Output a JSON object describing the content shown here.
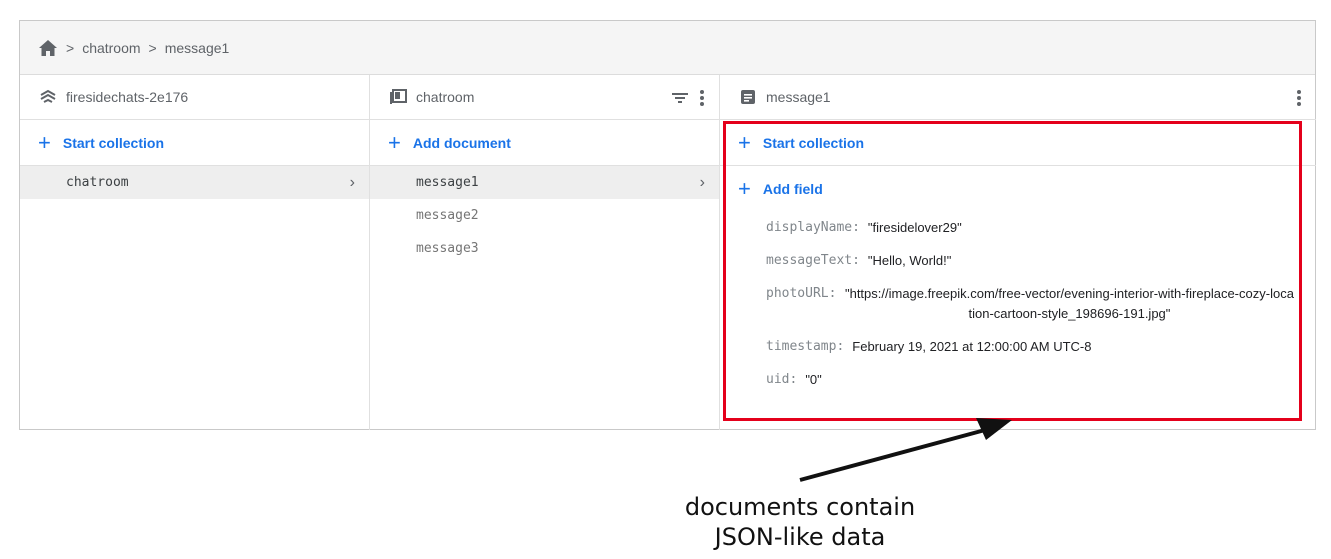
{
  "breadcrumb": {
    "home_icon": "home-icon",
    "separator": ">",
    "items": [
      "chatroom",
      "message1"
    ]
  },
  "columns": {
    "project": {
      "title": "firesidechats-2e176",
      "icon": "firebase-stack-icon",
      "action": "Start collection",
      "items": [
        {
          "label": "chatroom",
          "selected": true
        }
      ]
    },
    "collection": {
      "title": "chatroom",
      "icon": "collection-icon",
      "action": "Add document",
      "items": [
        {
          "label": "message1",
          "selected": true
        },
        {
          "label": "message2",
          "selected": false
        },
        {
          "label": "message3",
          "selected": false
        }
      ]
    },
    "document": {
      "title": "message1",
      "icon": "document-icon",
      "action_collection": "Start collection",
      "action_field": "Add field",
      "fields": [
        {
          "key": "displayName:",
          "value": "\"firesidelover29\""
        },
        {
          "key": "messageText:",
          "value": "\"Hello, World!\""
        },
        {
          "key": "photoURL:",
          "value": "\"https://image.freepik.com/free-vector/evening-interior-with-fireplace-cozy-location-cartoon-style_198696-191.jpg\""
        },
        {
          "key": "timestamp:",
          "value": "February 19, 2021 at 12:00:00 AM UTC-8"
        },
        {
          "key": "uid:",
          "value": "\"0\""
        }
      ]
    }
  },
  "annotation": {
    "line1": "documents contain",
    "line2": "JSON-like data"
  },
  "colors": {
    "accent": "#1a73e8",
    "highlight": "#e4001b"
  }
}
